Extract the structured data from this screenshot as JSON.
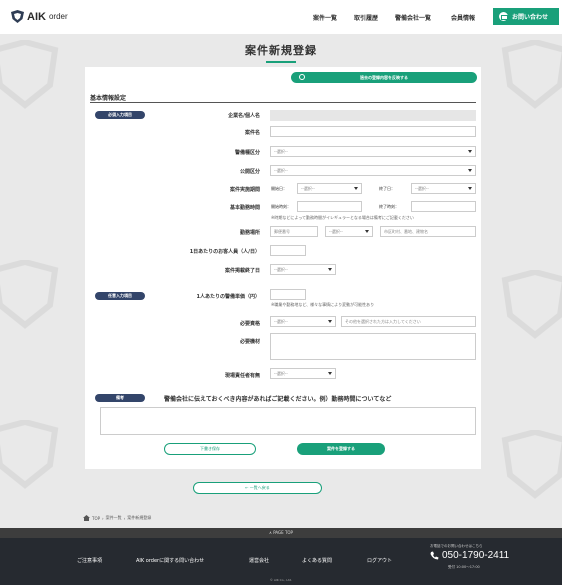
{
  "header": {
    "logo_main": "AIK",
    "logo_sub": "order",
    "nav": [
      "案件一覧",
      "取引履歴",
      "警備会社一覧",
      "会員情報"
    ],
    "contact_label": "お問い合わせ"
  },
  "page": {
    "title": "案件新規登録",
    "copy_button": "過去の登録内容を反映する",
    "section_title": "基本情報設定",
    "required_badge": "必須入力項目",
    "optional_badge": "任意入力項目",
    "notes_badge": "備考"
  },
  "form": {
    "company_label": "企業名/個人名",
    "project_label": "案件名",
    "security_label": "警備種区分",
    "security_value": "--選択--",
    "public_label": "公開区分",
    "public_value": "--選択--",
    "period_label": "案件実施期間",
    "start_label": "開始日：",
    "start_value": "--選択--",
    "end_label": "終了日：",
    "end_value": "--選択--",
    "hours_label": "基本勤務時間",
    "hours_start_label": "開始時刻：",
    "hours_end_label": "終了時刻：",
    "hours_note": "※時期などによって勤務時間がイレギュラーとなる場合は備考にご記載ください",
    "location_label": "勤務場所",
    "postal_placeholder": "郵便番号",
    "pref_value": "--選択--",
    "address_placeholder": "市区町村、番地、建物名",
    "guards_label": "1日あたりのお客人員（人/日）",
    "deadline_label": "案件掲載終了日",
    "deadline_value": "--選択--",
    "fee_label": "1人あたりの警備単価（円）",
    "fee_note": "※職業や勤務地など、様々な事情により変動が可能性あり",
    "qualification_label": "必要資格",
    "qualification_value": "--選択--",
    "qualification_placeholder": "その他を選択された方は入力してください",
    "equipment_label": "必要機材",
    "supervisor_label": "現場責任者有無",
    "supervisor_value": "--選択--",
    "notes_text": "警備会社に伝えておくべき内容があればご記載ください。例）勤務時間についてなど"
  },
  "buttons": {
    "draft": "下書き保存",
    "submit": "案件を登録する",
    "back": "← 一覧へ戻る"
  },
  "breadcrumb": [
    "TOP",
    "案件一覧",
    "案件新規登録"
  ],
  "footer": {
    "pagetop": "∧ PAGE TOP",
    "links": [
      "ご注意事項",
      "AIK orderに関する問い合わせ",
      "運営会社",
      "よくある質問",
      "ログアウト"
    ],
    "phone_note": "お電話でのお問い合わせはこちら",
    "phone": "050-1790-2411",
    "hours": "受付 10:00〜17:00",
    "copyright": "© AIK Co., Ltd."
  },
  "colors": {
    "accent": "#19a07a",
    "badge": "#33456a",
    "footer": "#262a30"
  }
}
